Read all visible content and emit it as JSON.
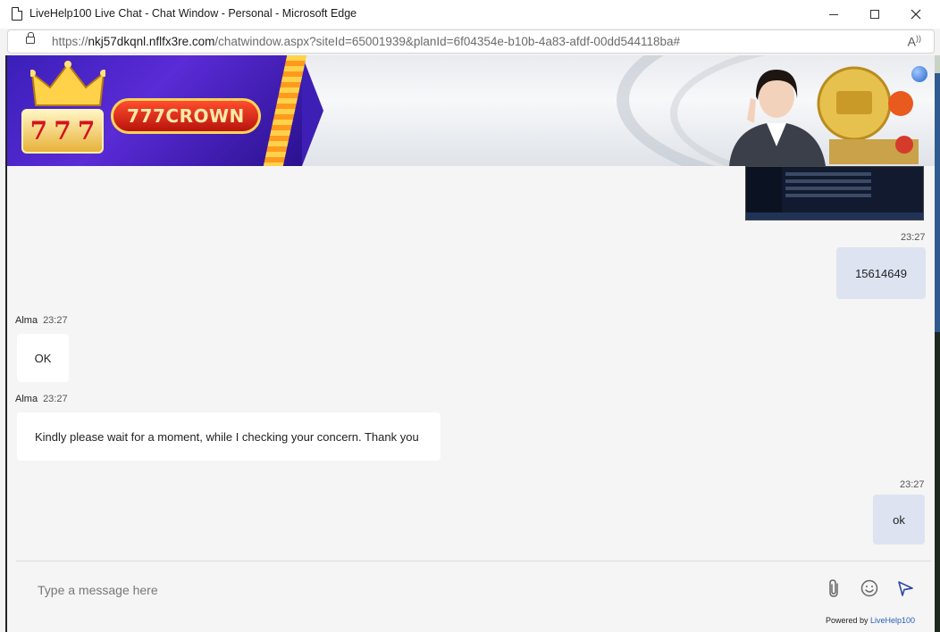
{
  "window": {
    "title": "LiveHelp100 Live Chat - Chat Window - Personal - Microsoft Edge"
  },
  "address": {
    "prefix": "https://",
    "host": "nkj57dkqnl.nflfx3re.com",
    "path": "/chatwindow.aspx?siteId=65001939&planId=6f04354e-b10b-4a83-afdf-00dd544118ba#"
  },
  "banner": {
    "slot_digits": [
      "7",
      "7",
      "7"
    ],
    "brand": "777CROWN"
  },
  "messages": {
    "m1_time": "23:27",
    "m1_text": "15614649",
    "m2_agent": "Alma",
    "m2_time": "23:27",
    "m2_text": "OK",
    "m3_agent": "Alma",
    "m3_time": "23:27",
    "m3_text": "Kindly please wait for a moment, while I checking your concern. Thank you",
    "m4_time": "23:27",
    "m4_text": "ok"
  },
  "composer": {
    "placeholder": "Type a message here"
  },
  "footer": {
    "powered_prefix": "Powered by ",
    "powered_link": "LiveHelp100"
  },
  "colors": {
    "outgoing_bubble": "#dde3f1",
    "incoming_bubble": "#ffffff",
    "link": "#2a5fb9",
    "send_icon": "#2a4aa8"
  },
  "icons": [
    "page-icon",
    "lock-icon",
    "read-aloud-icon",
    "minimize-icon",
    "maximize-icon",
    "close-icon",
    "attach-icon",
    "emoji-icon",
    "send-icon"
  ]
}
